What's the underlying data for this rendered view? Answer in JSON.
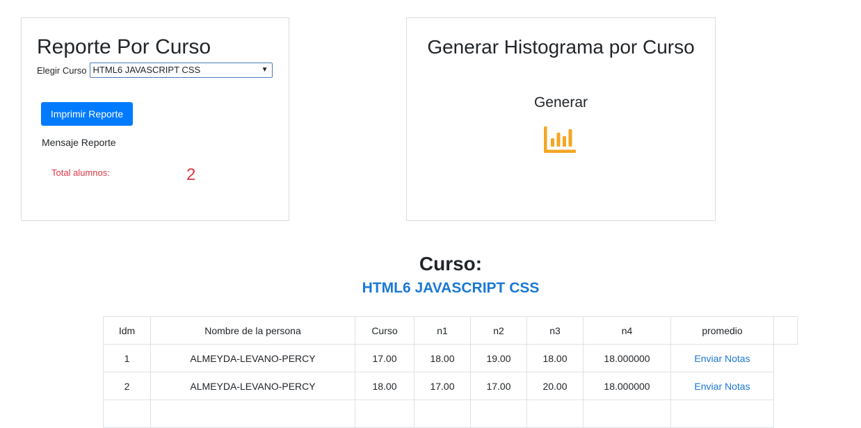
{
  "report_card": {
    "title": "Reporte Por Curso",
    "select_label": "Elegir Curso",
    "selected_course": "HTML6 JAVASCRIPT CSS",
    "print_button": "Imprimir Reporte",
    "message": "Mensaje Reporte",
    "total_label": "Total alumnos:",
    "total_value": "2"
  },
  "histogram_card": {
    "title": "Generar Histograma por Curso",
    "generate_label": "Generar",
    "icon": "bar-chart-icon",
    "icon_color": "#f5a623"
  },
  "course_header": {
    "label": "Curso:",
    "name": "HTML6 JAVASCRIPT CSS"
  },
  "table": {
    "headers": [
      "Idm",
      "Nombre de la persona",
      "Curso",
      "n1",
      "n2",
      "n3",
      "n4",
      "promedio"
    ],
    "rows": [
      [
        "1",
        "ALMEYDA-LEVANO-PERCY",
        "17.00",
        "18.00",
        "19.00",
        "18.00",
        "18.000000",
        "Enviar Notas"
      ],
      [
        "2",
        "ALMEYDA-LEVANO-PERCY",
        "18.00",
        "17.00",
        "17.00",
        "20.00",
        "18.000000",
        "Enviar Notas"
      ]
    ]
  },
  "colors": {
    "primary": "#007bff",
    "danger": "#dc3545",
    "link": "#1a78d6",
    "icon": "#f5a623"
  }
}
